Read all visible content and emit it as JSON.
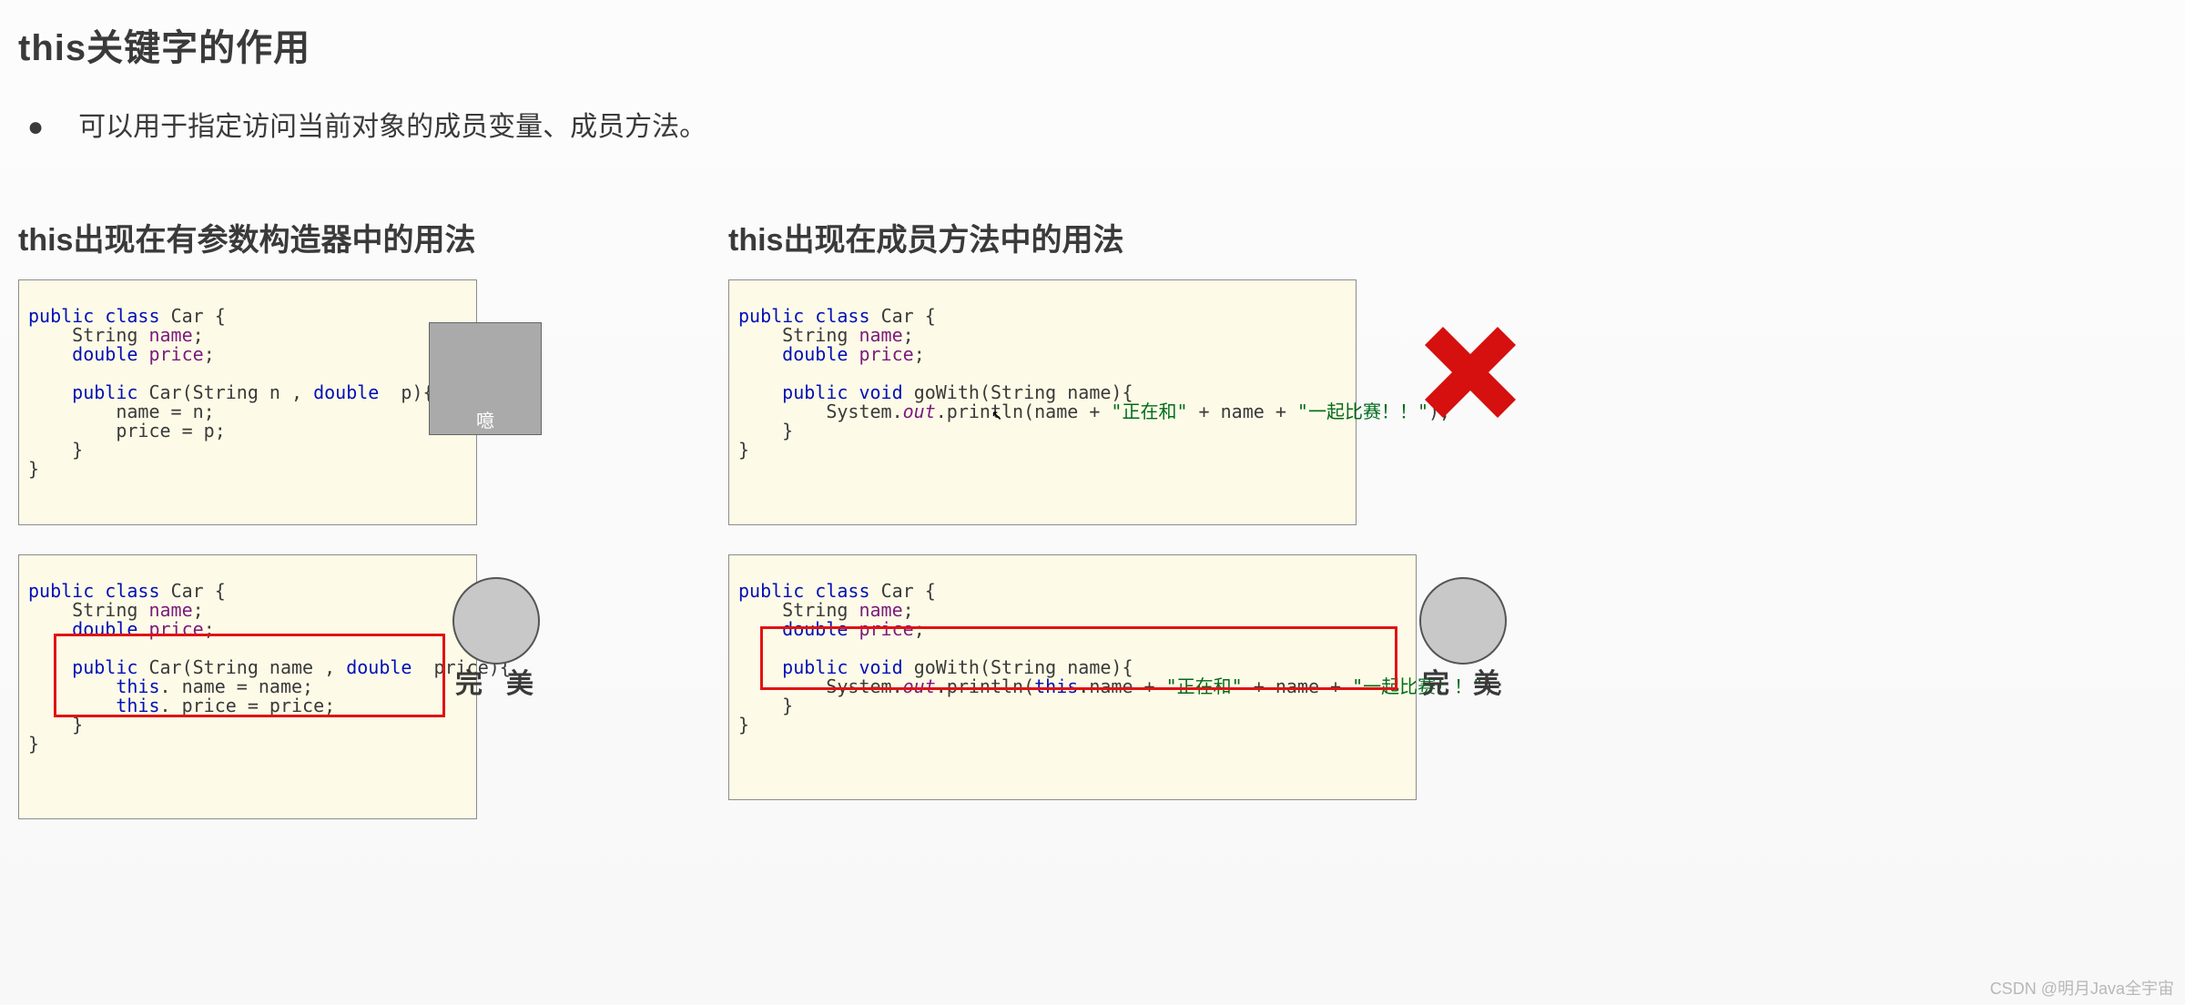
{
  "title": "this关键字的作用",
  "bullet": "可以用于指定访问当前对象的成员变量、成员方法。",
  "left_heading": "this出现在有参数构造器中的用法",
  "right_heading": "this出现在成员方法中的用法",
  "code": {
    "kw_public": "public",
    "kw_class": "class",
    "kw_void": "void",
    "kw_this": "this",
    "cls_car": "Car",
    "brace_open": " {",
    "brace_close": "}",
    "type_string": "String ",
    "type_double": "double ",
    "fld_name": "name",
    "fld_price": "price",
    "semi": ";",
    "l1_ctor_sig_a": "(String n , ",
    "l1_ctor_sig_b": " p){",
    "l1_assign_name": "name = n;",
    "l1_assign_price": "price = p;",
    "l2_ctor_sig_a": "(String name , ",
    "l2_ctor_sig_b": " price){",
    "l2_assign_name": ". name = name;",
    "l2_assign_price": ". price = price;",
    "gowith_name": "goWith",
    "gowith_sig": "(String name){",
    "sysout_a": "System.",
    "sysout_out": "out",
    "sysout_b": ".println(name + ",
    "sysout_b2": ".println(",
    "sysout_c": " + name + ",
    "str1": "\"正在和\"",
    "str2": "\"一起比赛！！\"",
    "paren_end": ");",
    "dot_name_plus": ".name + "
  },
  "memes": {
    "angry_caption": "噫",
    "perfect_label": "完 美"
  },
  "watermark": "CSDN @明月Java全宇宙"
}
